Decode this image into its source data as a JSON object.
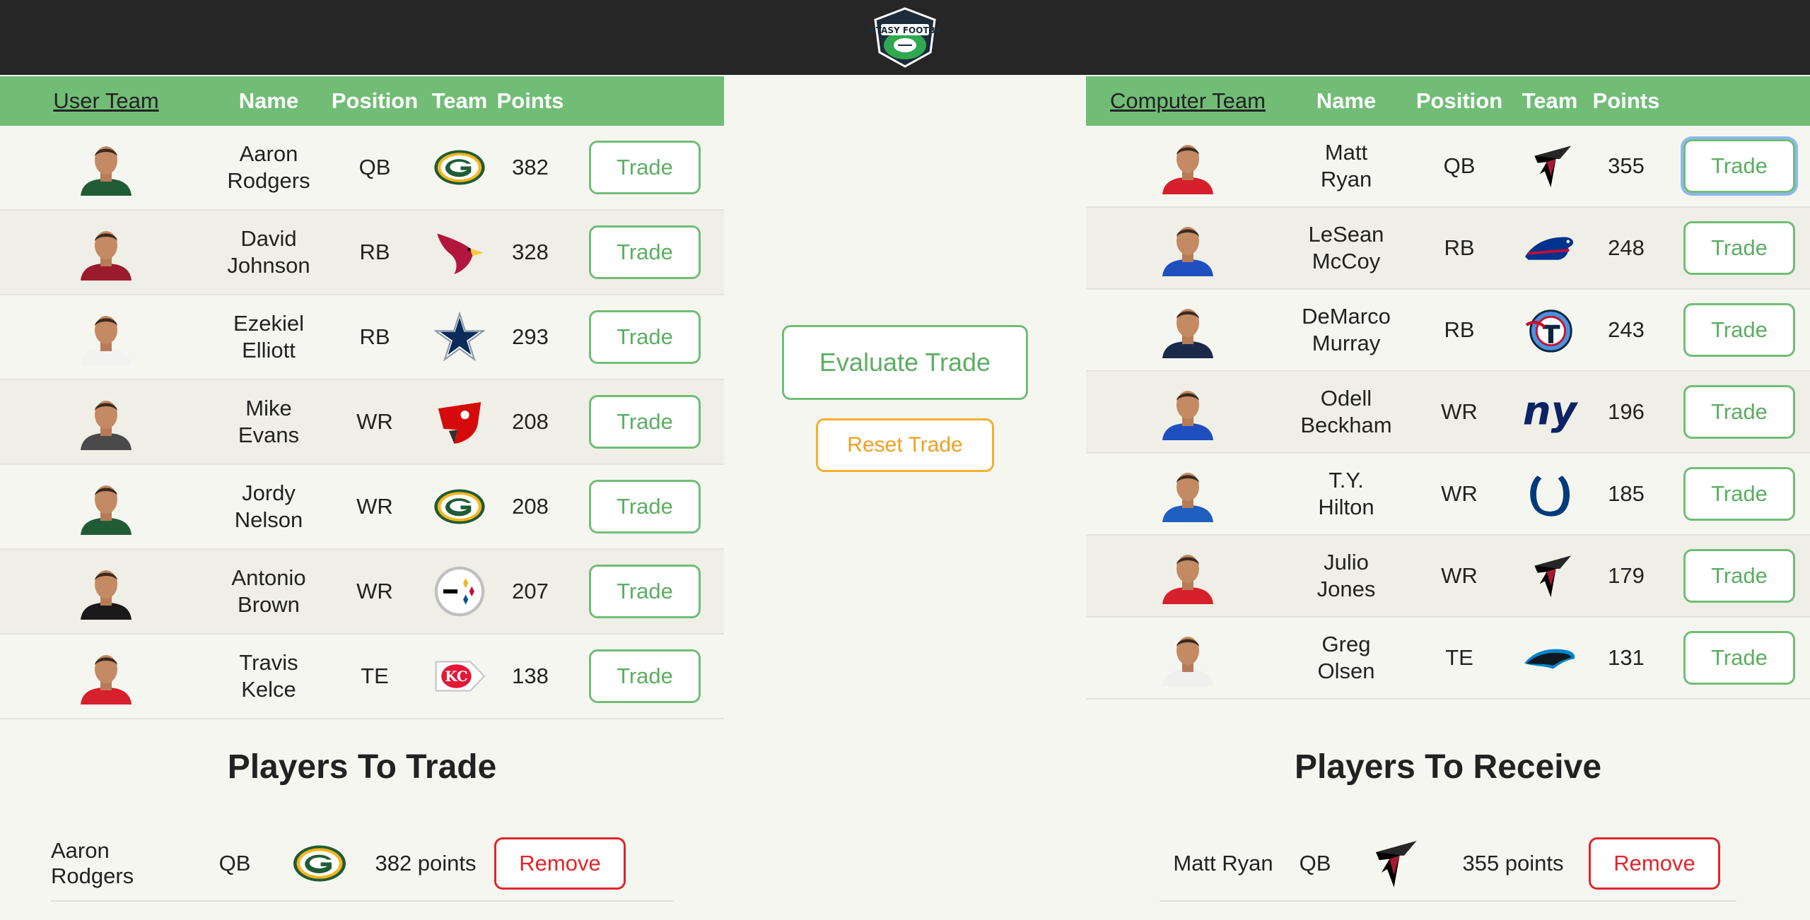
{
  "header": {
    "logo_text": "FANTASY FOOTBALL"
  },
  "user_team": {
    "columns": {
      "team": "User Team",
      "name": "Name",
      "position": "Position",
      "team_col": "Team",
      "points": "Points"
    },
    "trade_label": "Trade",
    "players": [
      {
        "first": "Aaron",
        "last": "Rodgers",
        "pos": "QB",
        "pts": "382",
        "team_icon": "packers-logo-icon",
        "jersey": "#1f5c35"
      },
      {
        "first": "David",
        "last": "Johnson",
        "pos": "RB",
        "pts": "328",
        "team_icon": "cardinals-logo-icon",
        "jersey": "#9b1a2c"
      },
      {
        "first": "Ezekiel",
        "last": "Elliott",
        "pos": "RB",
        "pts": "293",
        "team_icon": "cowboys-logo-icon",
        "jersey": "#f2f2f2"
      },
      {
        "first": "Mike",
        "last": "Evans",
        "pos": "WR",
        "pts": "208",
        "team_icon": "buccaneers-logo-icon",
        "jersey": "#4a4a4a"
      },
      {
        "first": "Jordy",
        "last": "Nelson",
        "pos": "WR",
        "pts": "208",
        "team_icon": "packers-logo-icon",
        "jersey": "#1f5c35"
      },
      {
        "first": "Antonio",
        "last": "Brown",
        "pos": "WR",
        "pts": "207",
        "team_icon": "steelers-logo-icon",
        "jersey": "#1a1a1a"
      },
      {
        "first": "Travis",
        "last": "Kelce",
        "pos": "TE",
        "pts": "138",
        "team_icon": "chiefs-logo-icon",
        "jersey": "#d6202b"
      }
    ]
  },
  "computer_team": {
    "columns": {
      "team": "Computer Team",
      "name": "Name",
      "position": "Position",
      "team_col": "Team",
      "points": "Points"
    },
    "trade_label": "Trade",
    "players": [
      {
        "first": "Matt",
        "last": "Ryan",
        "pos": "QB",
        "pts": "355",
        "team_icon": "falcons-logo-icon",
        "jersey": "#d6202b"
      },
      {
        "first": "LeSean",
        "last": "McCoy",
        "pos": "RB",
        "pts": "248",
        "team_icon": "bills-logo-icon",
        "jersey": "#1f4fbf"
      },
      {
        "first": "DeMarco",
        "last": "Murray",
        "pos": "RB",
        "pts": "243",
        "team_icon": "titans-logo-icon",
        "jersey": "#1b2a4a"
      },
      {
        "first": "Odell",
        "last": "Beckham",
        "pos": "WR",
        "pts": "196",
        "team_icon": "giants-logo-icon",
        "jersey": "#1f4fbf"
      },
      {
        "first": "T.Y.",
        "last": "Hilton",
        "pos": "WR",
        "pts": "185",
        "team_icon": "colts-logo-icon",
        "jersey": "#1f5fbf"
      },
      {
        "first": "Julio",
        "last": "Jones",
        "pos": "WR",
        "pts": "179",
        "team_icon": "falcons-logo-icon",
        "jersey": "#d6202b"
      },
      {
        "first": "Greg",
        "last": "Olsen",
        "pos": "TE",
        "pts": "131",
        "team_icon": "panthers-logo-icon",
        "jersey": "#f0f0f0"
      }
    ]
  },
  "actions": {
    "evaluate_label": "Evaluate Trade",
    "reset_label": "Reset Trade"
  },
  "players_to_trade": {
    "title": "Players To Trade",
    "items": [
      {
        "name": "Aaron Rodgers",
        "pos": "QB",
        "points": "382 points",
        "team_icon": "packers-logo-icon",
        "remove_label": "Remove"
      }
    ]
  },
  "players_to_receive": {
    "title": "Players To Receive",
    "items": [
      {
        "name": "Matt Ryan",
        "pos": "QB",
        "points": "355 points",
        "team_icon": "falcons-logo-icon",
        "remove_label": "Remove"
      }
    ]
  },
  "colors": {
    "header_bg": "#262626",
    "table_header": "#71bd76",
    "trade_green": "#5cae62",
    "reset_orange": "#f5b02e",
    "remove_red": "#e0262a"
  }
}
